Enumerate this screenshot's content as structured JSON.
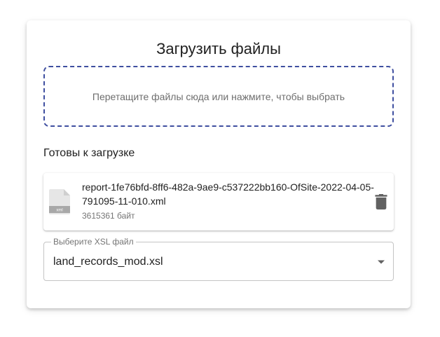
{
  "upload": {
    "title": "Загрузить файлы",
    "dropzone_text": "Перетащите файлы сюда или нажмите, чтобы выбрать"
  },
  "ready": {
    "section_title": "Готовы к загрузке",
    "files": [
      {
        "name": "report-1fe76bfd-8ff6-482a-9ae9-c537222bb160-OfSite-2022-04-05-791095-11-010.xml",
        "size": "3615361 байт",
        "icon": "xml-file-icon",
        "icon_label": "xml"
      }
    ]
  },
  "xsl_select": {
    "label": "Выберите XSL файл",
    "value": "land_records_mod.xsl"
  },
  "colors": {
    "dropzone_border": "#3f4fa0",
    "icon_gray": "#616161"
  }
}
